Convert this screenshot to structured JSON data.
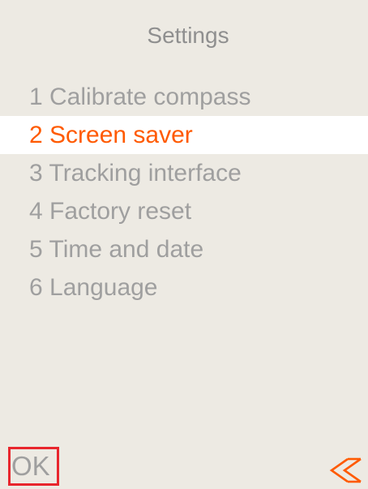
{
  "screen": {
    "title": "Settings"
  },
  "menu": {
    "items": [
      {
        "label": "1 Calibrate compass",
        "selected": false
      },
      {
        "label": "2 Screen saver",
        "selected": true
      },
      {
        "label": "3 Tracking interface",
        "selected": false
      },
      {
        "label": "4 Factory reset",
        "selected": false
      },
      {
        "label": "5 Time and date",
        "selected": false
      },
      {
        "label": "6 Language",
        "selected": false
      }
    ]
  },
  "footer": {
    "ok_label": "OK",
    "back_icon": "double-chevron-left-icon"
  },
  "colors": {
    "background": "#edeae3",
    "text": "#9f9f9f",
    "accent": "#ff5a00",
    "ok_border": "#e8262d"
  }
}
